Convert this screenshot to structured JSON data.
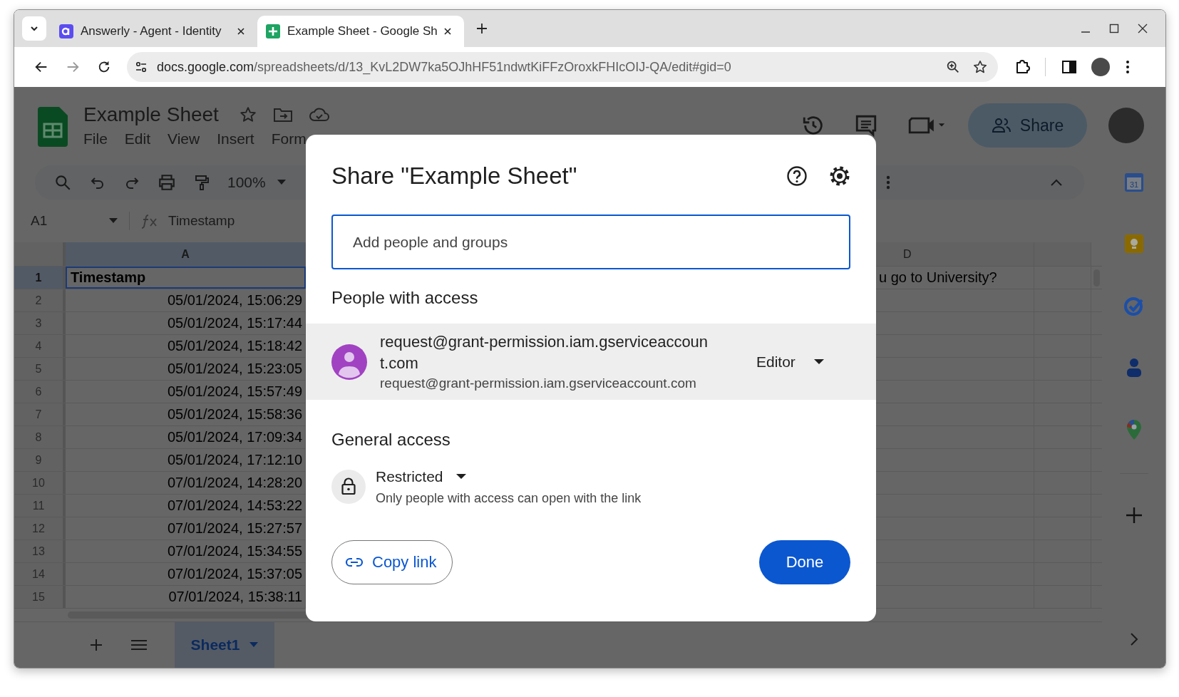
{
  "browser": {
    "tabs": [
      {
        "title": "Answerly - Agent - Identity",
        "selected": false
      },
      {
        "title": "Example Sheet - Google Sh",
        "selected": true
      }
    ],
    "url": {
      "host": "docs.google.com",
      "path": "/spreadsheets/d/13_KvL2DW7ka5OJhHF51ndwtKiFFzOroxkFHIcOIJ-QA/edit#gid=0"
    }
  },
  "document": {
    "title": "Example Sheet",
    "menu": [
      "File",
      "Edit",
      "View",
      "Insert",
      "Form"
    ],
    "share_button": "Share"
  },
  "toolbar": {
    "zoom": "100%"
  },
  "formula_bar": {
    "cell_ref": "A1",
    "content": "Timestamp"
  },
  "grid": {
    "columns": [
      {
        "label": "A",
        "selected": true
      },
      {
        "label": "D",
        "selected": false
      }
    ],
    "rows": [
      {
        "number": "1",
        "selected": true,
        "a": "Timestamp",
        "d": "u go to University?"
      },
      {
        "number": "2",
        "selected": false,
        "a": "05/01/2024, 15:06:29"
      },
      {
        "number": "3",
        "selected": false,
        "a": "05/01/2024, 15:17:44"
      },
      {
        "number": "4",
        "selected": false,
        "a": "05/01/2024, 15:18:42"
      },
      {
        "number": "5",
        "selected": false,
        "a": "05/01/2024, 15:23:05"
      },
      {
        "number": "6",
        "selected": false,
        "a": "05/01/2024, 15:57:49"
      },
      {
        "number": "7",
        "selected": false,
        "a": "05/01/2024, 15:58:36"
      },
      {
        "number": "8",
        "selected": false,
        "a": "05/01/2024, 17:09:34"
      },
      {
        "number": "9",
        "selected": false,
        "a": "05/01/2024, 17:12:10"
      },
      {
        "number": "10",
        "selected": false,
        "a": "07/01/2024, 14:28:20"
      },
      {
        "number": "11",
        "selected": false,
        "a": "07/01/2024, 14:53:22"
      },
      {
        "number": "12",
        "selected": false,
        "a": "07/01/2024, 15:27:57"
      },
      {
        "number": "13",
        "selected": false,
        "a": "07/01/2024, 15:34:55"
      },
      {
        "number": "14",
        "selected": false,
        "a": "07/01/2024, 15:37:05"
      },
      {
        "number": "15",
        "selected": false,
        "a": "07/01/2024, 15:38:11"
      }
    ]
  },
  "side_panel": {
    "calendar_day": "31"
  },
  "sheet_tabs": [
    {
      "label": "Sheet1",
      "selected": true
    }
  ],
  "dialog": {
    "title": "Share \"Example Sheet\"",
    "placeholder": "Add people and groups",
    "people_heading": "People with access",
    "people": [
      {
        "name": "request@grant-permission.iam.gserviceaccount.com",
        "email": "request@grant-permission.iam.gserviceaccount.com",
        "role": "Editor"
      }
    ],
    "general_heading": "General access",
    "access": {
      "level": "Restricted",
      "description": "Only people with access can open with the link"
    },
    "copy_link": "Copy link",
    "done": "Done"
  }
}
